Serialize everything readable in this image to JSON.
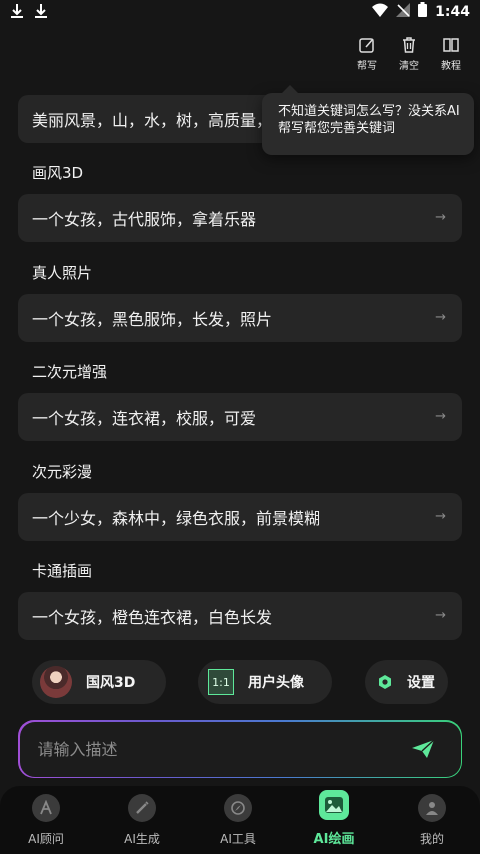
{
  "status_bar": {
    "time": "1:44"
  },
  "toolbar": {
    "write_label": "帮写",
    "clear_label": "清空",
    "tutorial_label": "教程"
  },
  "prompt_card": {
    "text": "美丽风景，山，水，树，高质量，"
  },
  "tooltip": {
    "text": "不知道关键词怎么写？没关系AI帮写帮您完善关键词"
  },
  "styles": [
    {
      "title": "画风3D",
      "example": "一个女孩，古代服饰，拿着乐器"
    },
    {
      "title": "真人照片",
      "example": "一个女孩，黑色服饰，长发，照片"
    },
    {
      "title": "二次元增强",
      "example": "一个女孩，连衣裙，校服，可爱"
    },
    {
      "title": "次元彩漫",
      "example": "一个少女，森林中，绿色衣服，前景模糊"
    },
    {
      "title": "卡通插画",
      "example": "一个女孩，橙色连衣裙，白色长发"
    }
  ],
  "chips": {
    "style_label": "国风3D",
    "ratio_icon_text": "1:1",
    "ratio_label": "用户头像",
    "settings_label": "设置"
  },
  "input": {
    "placeholder": "请输入描述",
    "value": ""
  },
  "tabs": [
    {
      "label": "AI顾问",
      "icon": "ai-advisor-icon"
    },
    {
      "label": "AI生成",
      "icon": "ai-generate-icon"
    },
    {
      "label": "AI工具",
      "icon": "ai-tools-icon"
    },
    {
      "label": "AI绘画",
      "icon": "ai-paint-icon",
      "active": true
    },
    {
      "label": "我的",
      "icon": "profile-icon"
    }
  ],
  "colors": {
    "background": "#161616",
    "card": "#262626",
    "accent_green": "#5ee89a"
  }
}
